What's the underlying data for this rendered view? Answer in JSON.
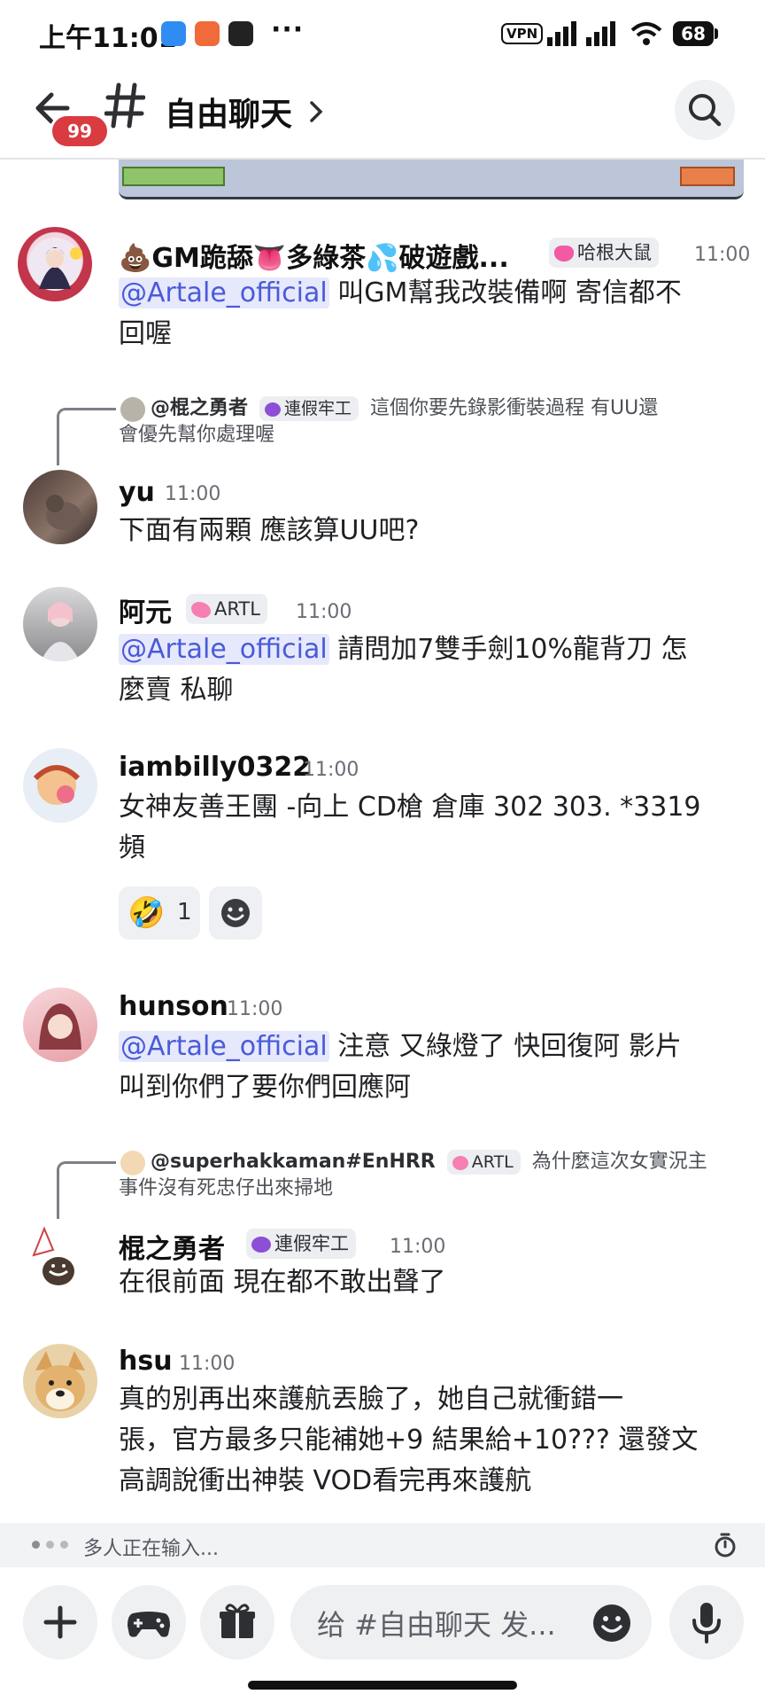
{
  "status_bar": {
    "time": "上午11:01",
    "dots": "···",
    "vpn": "VPN",
    "battery": "68"
  },
  "header": {
    "back_badge": "99",
    "channel_name": "自由聊天"
  },
  "messages": [
    {
      "user": "💩GM跪舔👅多綠茶💦破遊戲...",
      "role": "哈根大鼠",
      "time": "11:00",
      "mention": "@Artale_official",
      "text_after_mention": " 叫GM幫我改裝備啊  寄信都不",
      "line2": "回喔"
    },
    {
      "reply": {
        "user": "@棍之勇者",
        "role": "連假牢工",
        "text1": "這個你要先錄影衝裝過程 有UU還",
        "text2": "會優先幫你處理喔"
      },
      "user": "yu",
      "time": "11:00",
      "text": "下面有兩顆 應該算UU吧?"
    },
    {
      "user": "阿元",
      "role": "ARTL",
      "time": "11:00",
      "mention": "@Artale_official",
      "text_after_mention": " 請問加7雙手劍10%龍背刀 怎",
      "line2": "麼賣 私聊"
    },
    {
      "user": "iambilly0322",
      "time": "11:00",
      "text": "女神友善王團 -向上 CD槍 倉庫 302 303.  *3319",
      "line2": "頻",
      "reaction": {
        "emoji": "🤣",
        "count": "1"
      }
    },
    {
      "user": "hunson",
      "time": "11:00",
      "mention": "@Artale_official",
      "text_after_mention": " 注意 又綠燈了 快回復阿 影片",
      "line2": "叫到你們了要你們回應阿"
    },
    {
      "reply": {
        "user": "@superhakkaman#EnHRR",
        "role": "ARTL",
        "text1": "為什麼這次女實況主",
        "text2": "事件沒有死忠仔出來掃地"
      },
      "user": "棍之勇者",
      "role": "連假牢工",
      "time": "11:00",
      "text": "在很前面 現在都不敢出聲了"
    },
    {
      "user": "hsu",
      "time": "11:00",
      "line1": "真的別再出來護航丟臉了，她自己就衝錯一",
      "line2": "張，官方最多只能補她+9 結果給+10??? 還發文",
      "line3": "高調說衝出神裝 VOD看完再來護航"
    }
  ],
  "typing": {
    "text": "多人正在输入..."
  },
  "composer": {
    "placeholder": "给 #自由聊天 发..."
  },
  "colors": {
    "mention_bg": "#e6e9fb",
    "mention_fg": "#4a5ad9",
    "badge_red": "#d93b40"
  }
}
